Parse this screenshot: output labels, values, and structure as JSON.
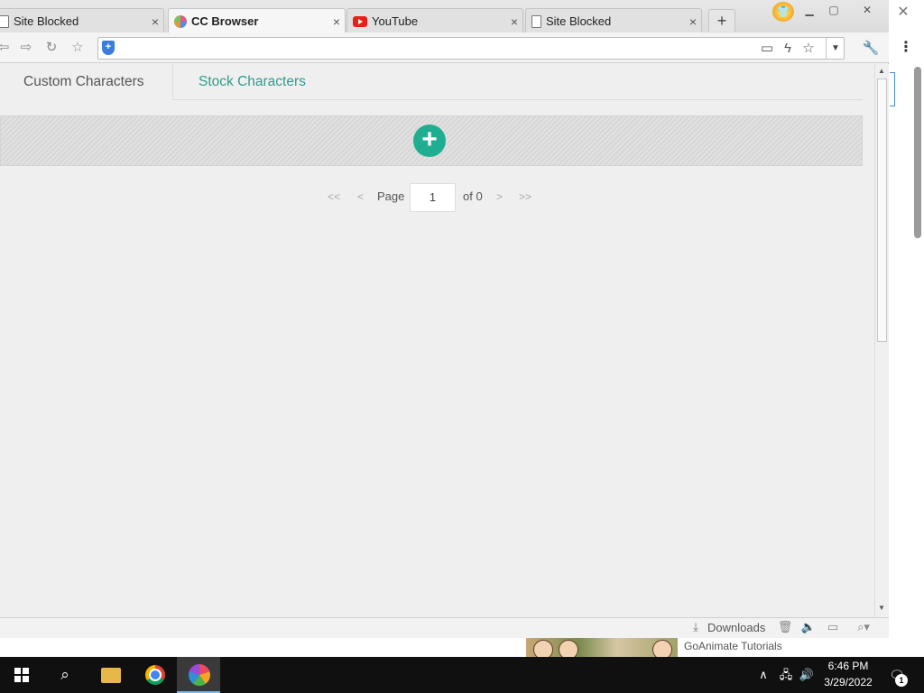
{
  "browser": {
    "tabs": [
      {
        "label": "Site Blocked",
        "icon": "page-icon"
      },
      {
        "label": "CC Browser",
        "icon": "cc-icon",
        "active": true
      },
      {
        "label": "YouTube",
        "icon": "youtube-icon"
      },
      {
        "label": "Site Blocked",
        "icon": "page-icon"
      }
    ],
    "new_tab_label": "+",
    "close_glyph": "×"
  },
  "content": {
    "tabs": {
      "custom": "Custom Characters",
      "stock": "Stock Characters"
    },
    "add_glyph": "+",
    "pager": {
      "first": "<<",
      "prev": "<",
      "page_label": "Page",
      "page_value": "1",
      "of_label": "of 0",
      "next": ">",
      "last": ">>"
    }
  },
  "statusbar": {
    "downloads": "Downloads"
  },
  "behind": {
    "label": "GoAnimate Tutorials"
  },
  "taskbar": {
    "time": "6:46 PM",
    "date": "3/29/2022",
    "notifications": "1"
  },
  "colors": {
    "accent": "#2e9b8e",
    "add_button": "#1fae91",
    "taskbar": "#101010"
  }
}
